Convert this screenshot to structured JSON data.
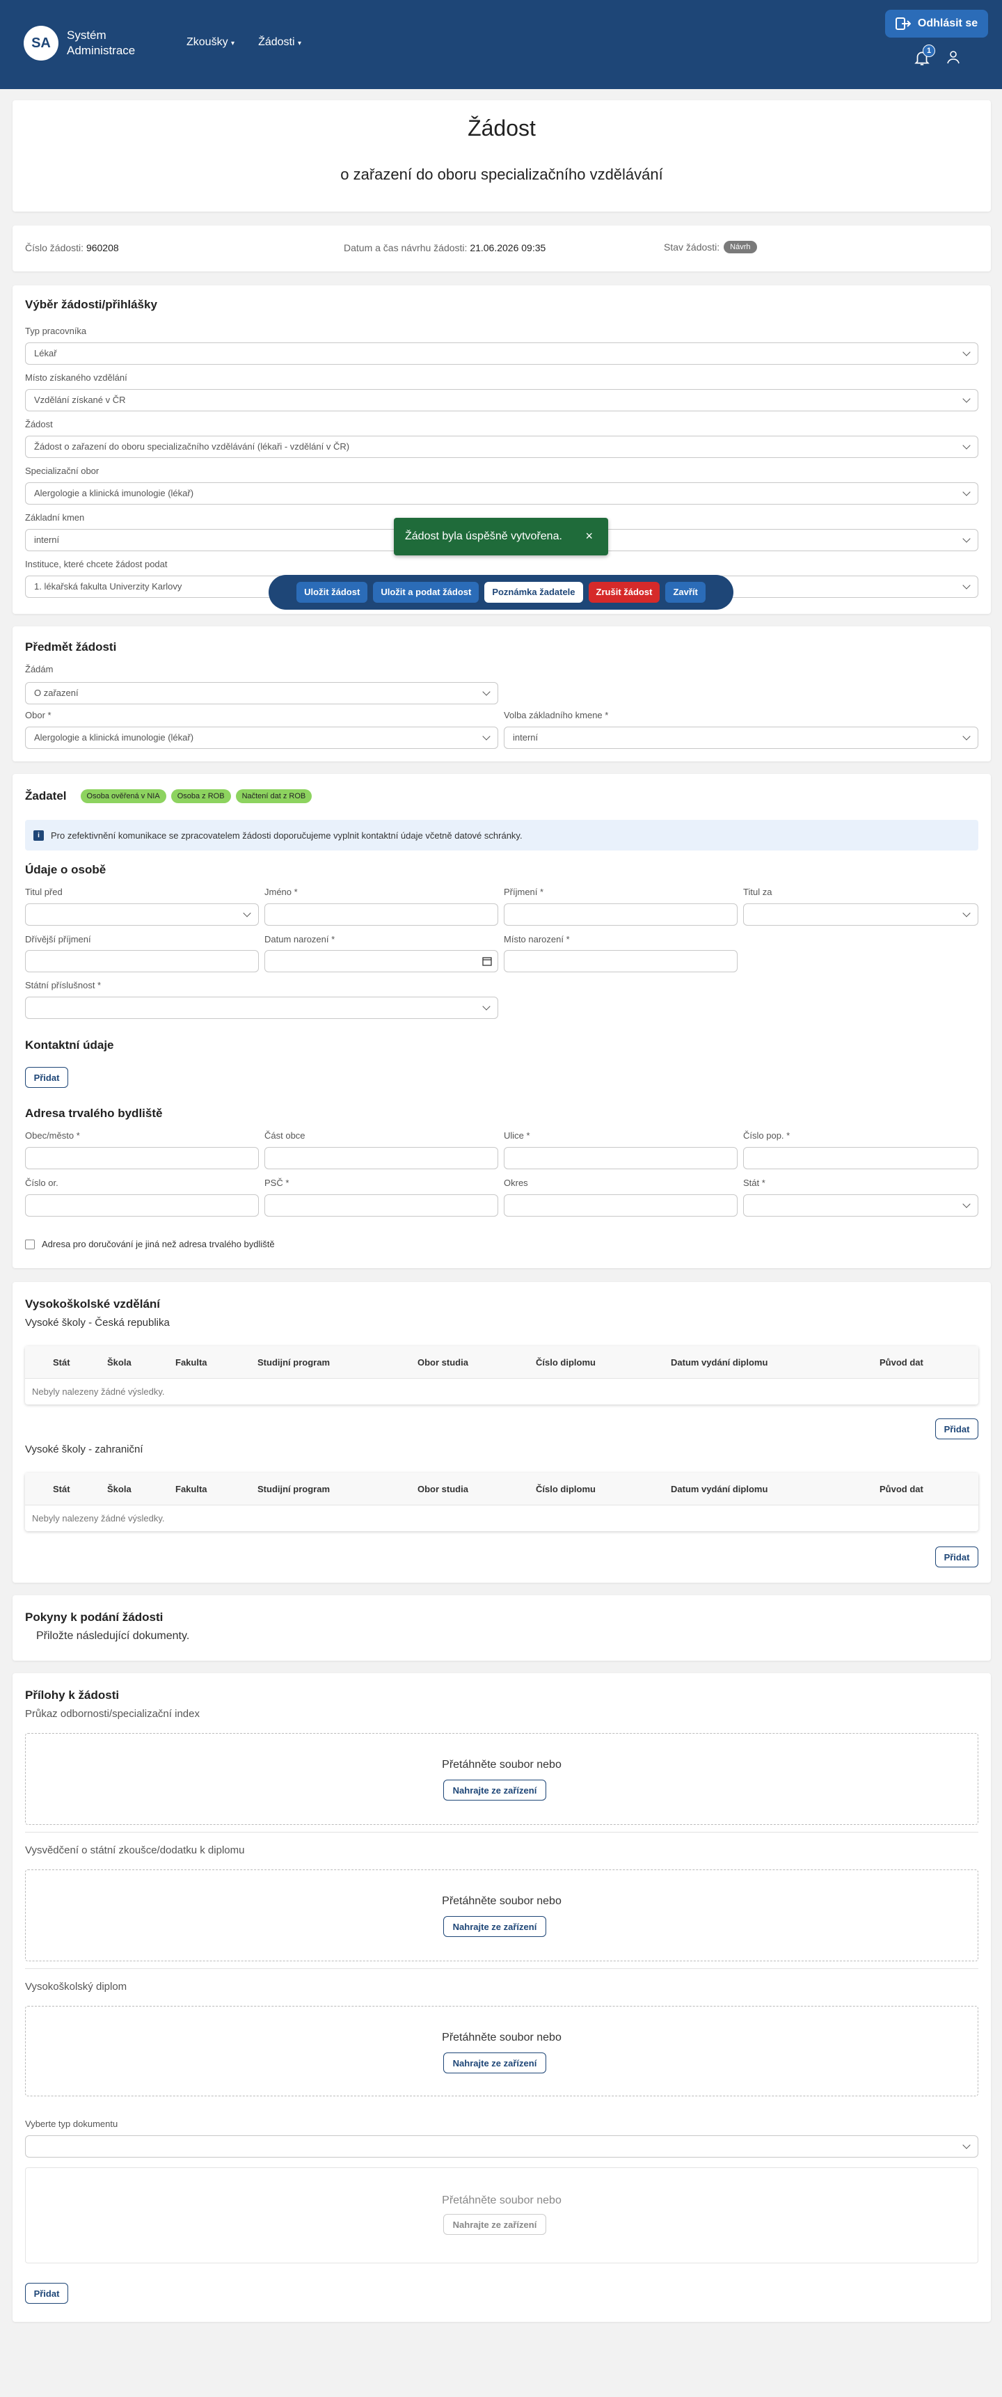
{
  "header": {
    "logo_initials": "SA",
    "logo_line1": "Systém",
    "logo_line2": "Administrace",
    "nav": [
      "Zkoušky",
      "Žádosti"
    ],
    "logout_label": "Odhlásit se",
    "notification_count": "1"
  },
  "title": {
    "main": "Žádost",
    "sub": "o zařazení do oboru specializačního vzdělávání"
  },
  "info": {
    "number_label": "Číslo žádosti:",
    "number_value": "960208",
    "date_label": "Datum a čas návrhu žádosti:",
    "date_value": "21.06.2026 09:35",
    "state_label": "Stav žádosti:",
    "state_value": "Návrh"
  },
  "selection": {
    "title": "Výběr žádosti/přihlášky",
    "fields": [
      {
        "label": "Typ pracovníka",
        "value": "Lékař"
      },
      {
        "label": "Místo získaného vzdělání",
        "value": "Vzdělání získané v ČR"
      },
      {
        "label": "Žádost",
        "value": "Žádost o zařazení do oboru specializačního vzdělávání (lékaři - vzdělání v ČR)"
      },
      {
        "label": "Specializační obor",
        "value": "Alergologie a klinická imunologie (lékař)"
      },
      {
        "label": "Základní kmen",
        "value": "interní"
      },
      {
        "label": "Instituce, které chcete žádost podat",
        "value": "1. lékařská fakulta Univerzity Karlovy"
      }
    ]
  },
  "toast": {
    "text": "Žádost byla úspěšně vytvořena.",
    "close": "×"
  },
  "toolbar": {
    "save": "Uložit žádost",
    "save_submit": "Uložit a podat žádost",
    "note": "Poznámka žadatele",
    "cancel": "Zrušit žádost",
    "close": "Zavřít"
  },
  "subject": {
    "title": "Předmět žádosti",
    "request_label": "Žádám",
    "request_value": "O zařazení",
    "field_label": "Obor *",
    "field_value": "Alergologie a klinická imunologie (lékař)",
    "trunk_label": "Volba základního kmene *",
    "trunk_value": "interní"
  },
  "applicant": {
    "title": "Žadatel",
    "tags": [
      "Osoba ověřená v NIA",
      "Osoba z ROB",
      "Načtení dat z ROB"
    ],
    "notice": "Pro zefektivnění komunikace se zpracovatelem žádosti doporučujeme vyplnit kontaktní údaje včetně datové schránky.",
    "person_title": "Údaje o osobě",
    "title_before": "Titul před",
    "first_name": "Jméno *",
    "last_name": "Příjmení *",
    "title_after": "Titul za",
    "former_name": "Dřívější příjmení",
    "birth_date": "Datum narození *",
    "birth_place": "Místo narození *",
    "citizenship": "Státní příslušnost *",
    "contacts_title": "Kontaktní údaje",
    "add": "Přidat",
    "address_title": "Adresa trvalého bydliště",
    "city": "Obec/město *",
    "district_part": "Část obce",
    "street": "Ulice *",
    "house_no": "Číslo pop. *",
    "orient_no": "Číslo or.",
    "zip": "PSČ *",
    "county": "Okres",
    "state": "Stát *",
    "delivery_checkbox": "Adresa pro doručování je jiná než adresa trvalého bydliště"
  },
  "education": {
    "title": "Vysokoškolské vzdělání",
    "cz_title": "Vysoké školy - Česká republika",
    "foreign_title": "Vysoké školy - zahraniční",
    "columns": [
      "Stát",
      "Škola",
      "Fakulta",
      "Studijní program",
      "Obor studia",
      "Číslo diplomu",
      "Datum vydání diplomu",
      "Původ dat"
    ],
    "empty": "Nebyly nalezeny žádné výsledky.",
    "add": "Přidat"
  },
  "instructions": {
    "title": "Pokyny k podání žádosti",
    "text": "Přiložte následující dokumenty."
  },
  "attachments": {
    "title": "Přílohy k žádosti",
    "drop_text": "Přetáhněte soubor nebo",
    "upload": "Nahrajte ze zařízení",
    "items": [
      "Průkaz odbornosti/specializační index",
      "Vysvědčení o státní zkoušce/dodatku k diplomu",
      "Vysokoškolský diplom"
    ],
    "doc_type_label": "Vyberte typ dokumentu",
    "add": "Přidat"
  }
}
